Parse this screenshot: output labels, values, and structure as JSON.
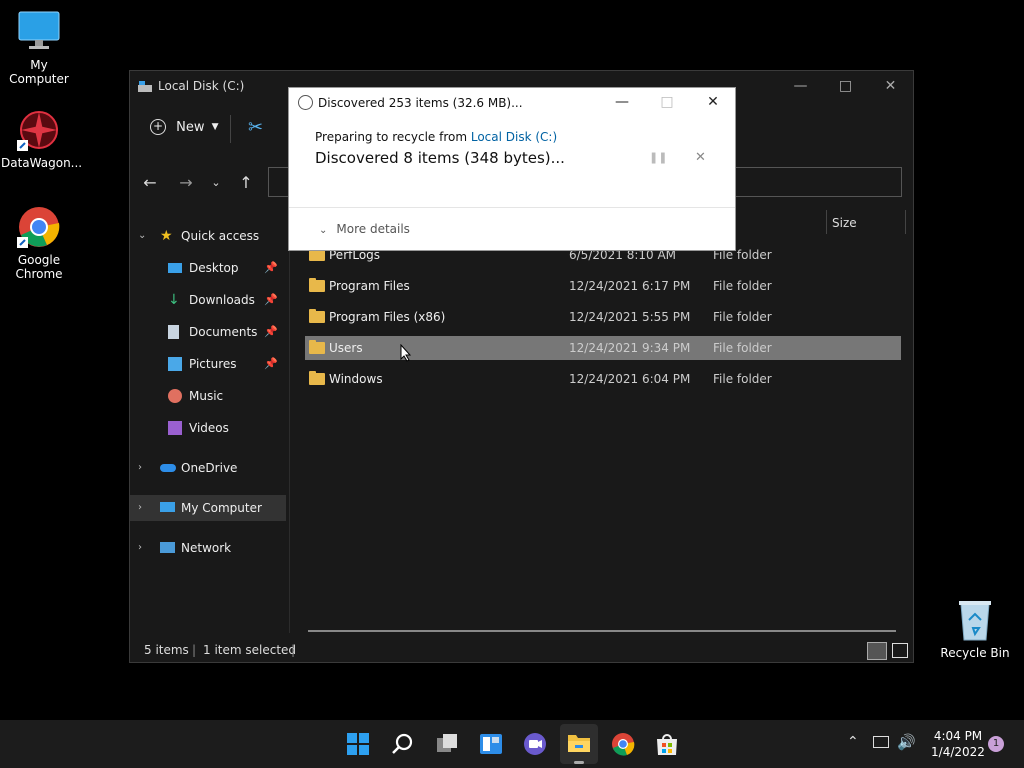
{
  "desktop": {
    "icons": [
      {
        "label": "My Computer"
      },
      {
        "label": "DataWagon..."
      },
      {
        "label": "Google Chrome"
      },
      {
        "label": "Recycle Bin"
      }
    ]
  },
  "explorer": {
    "title": "Local Disk (C:)",
    "toolbar": {
      "new_label": "New"
    },
    "sidebar": {
      "quick_access": "Quick access",
      "items": [
        {
          "label": "Desktop",
          "pinned": true
        },
        {
          "label": "Downloads",
          "pinned": true
        },
        {
          "label": "Documents",
          "pinned": true
        },
        {
          "label": "Pictures",
          "pinned": true
        },
        {
          "label": "Music",
          "pinned": false
        },
        {
          "label": "Videos",
          "pinned": false
        }
      ],
      "onedrive": "OneDrive",
      "my_computer": "My Computer",
      "network": "Network"
    },
    "columns": {
      "size": "Size"
    },
    "rows": [
      {
        "name": "PerfLogs",
        "date": "6/5/2021 8:10 AM",
        "type": "File folder"
      },
      {
        "name": "Program Files",
        "date": "12/24/2021 6:17 PM",
        "type": "File folder"
      },
      {
        "name": "Program Files (x86)",
        "date": "12/24/2021 5:55 PM",
        "type": "File folder"
      },
      {
        "name": "Users",
        "date": "12/24/2021 9:34 PM",
        "type": "File folder"
      },
      {
        "name": "Windows",
        "date": "12/24/2021 6:04 PM",
        "type": "File folder"
      }
    ],
    "status": {
      "items": "5 items",
      "selected": "1 item selected"
    }
  },
  "dialog": {
    "title": "Discovered 253 items (32.6 MB)...",
    "preparing_prefix": "Preparing to recycle from ",
    "preparing_link": "Local Disk (C:)",
    "progress_text": "Discovered 8 items (348 bytes)...",
    "more_details": "More details"
  },
  "taskbar": {
    "time": "4:04 PM",
    "date": "1/4/2022",
    "notification_count": "1"
  },
  "colors": {
    "accent": "#0067c0",
    "link": "#0062a3",
    "selection": "#777777",
    "folder": "#e8b84a"
  }
}
